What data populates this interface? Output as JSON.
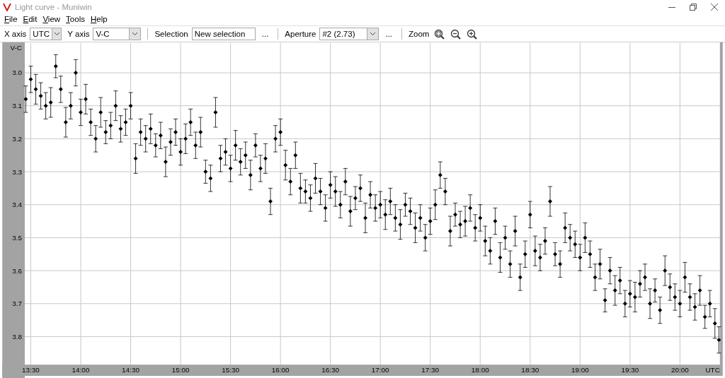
{
  "window": {
    "title": "Light curve - Muniwin"
  },
  "menu": [
    "File",
    "Edit",
    "View",
    "Tools",
    "Help"
  ],
  "toolbar": {
    "x_axis": {
      "label": "X axis",
      "value": "UTC"
    },
    "y_axis": {
      "label": "Y axis",
      "value": "V-C"
    },
    "selection": {
      "label": "Selection",
      "value": "New selection",
      "button": "..."
    },
    "aperture": {
      "label": "Aperture",
      "value": "#2 (2.73)",
      "button": "..."
    },
    "zoom": {
      "label": "Zoom"
    }
  },
  "chart": {
    "chart_data": {
      "type": "scatter",
      "xlabel": "UTC",
      "ylabel": "V-C",
      "grid": true,
      "xlim": [
        13.44,
        20.4
      ],
      "ylim": [
        3.885,
        2.91
      ],
      "xticks": [
        {
          "value": 13.5,
          "label": "13:30"
        },
        {
          "value": 14,
          "label": "14:00"
        },
        {
          "value": 14.5,
          "label": "14:30"
        },
        {
          "value": 15,
          "label": "15:00"
        },
        {
          "value": 15.5,
          "label": "15:30"
        },
        {
          "value": 16,
          "label": "16:00"
        },
        {
          "value": 16.5,
          "label": "16:30"
        },
        {
          "value": 17,
          "label": "17:00"
        },
        {
          "value": 17.5,
          "label": "17:30"
        },
        {
          "value": 18,
          "label": "18:00"
        },
        {
          "value": 18.5,
          "label": "18:30"
        },
        {
          "value": 19,
          "label": "19:00"
        },
        {
          "value": 19.5,
          "label": "19:30"
        },
        {
          "value": 20,
          "label": "20:00"
        }
      ],
      "yticks": [
        {
          "value": 3.0,
          "label": "3.0"
        },
        {
          "value": 3.1,
          "label": "3.1"
        },
        {
          "value": 3.2,
          "label": "3.2"
        },
        {
          "value": 3.3,
          "label": "3.3"
        },
        {
          "value": 3.4,
          "label": "3.4"
        },
        {
          "value": 3.5,
          "label": "3.5"
        },
        {
          "value": 3.6,
          "label": "3.6"
        },
        {
          "value": 3.7,
          "label": "3.7"
        },
        {
          "value": 3.8,
          "label": "3.8"
        }
      ],
      "x": [
        13.45,
        13.5,
        13.55,
        13.6,
        13.65,
        13.7,
        13.75,
        13.8,
        13.85,
        13.9,
        13.95,
        14,
        14.05,
        14.1,
        14.15,
        14.2,
        14.25,
        14.3,
        14.35,
        14.4,
        14.45,
        14.5,
        14.55,
        14.6,
        14.65,
        14.7,
        14.75,
        14.8,
        14.85,
        14.9,
        14.95,
        15,
        15.05,
        15.1,
        15.15,
        15.2,
        15.25,
        15.3,
        15.35,
        15.4,
        15.45,
        15.5,
        15.55,
        15.6,
        15.65,
        15.7,
        15.75,
        15.8,
        15.85,
        15.9,
        15.95,
        16,
        16.05,
        16.1,
        16.15,
        16.2,
        16.25,
        16.3,
        16.35,
        16.4,
        16.45,
        16.5,
        16.55,
        16.6,
        16.65,
        16.7,
        16.75,
        16.8,
        16.85,
        16.9,
        16.95,
        17,
        17.05,
        17.1,
        17.15,
        17.2,
        17.25,
        17.3,
        17.35,
        17.4,
        17.45,
        17.5,
        17.55,
        17.6,
        17.65,
        17.7,
        17.75,
        17.8,
        17.85,
        17.9,
        17.95,
        18,
        18.05,
        18.1,
        18.15,
        18.2,
        18.25,
        18.3,
        18.35,
        18.4,
        18.45,
        18.5,
        18.55,
        18.6,
        18.65,
        18.7,
        18.75,
        18.8,
        18.85,
        18.9,
        18.95,
        19,
        19.05,
        19.1,
        19.15,
        19.2,
        19.25,
        19.3,
        19.35,
        19.4,
        19.45,
        19.5,
        19.55,
        19.6,
        19.65,
        19.7,
        19.75,
        19.8,
        19.85,
        19.9,
        19.95,
        20,
        20.05,
        20.1,
        20.15,
        20.2,
        20.25,
        20.3,
        20.35,
        20.39
      ],
      "series": [
        {
          "color": "#000000",
          "errors": [
            0.04,
            0.04,
            0.045,
            0.04,
            0.04,
            0.045,
            0.035,
            0.04,
            0.045,
            0.04,
            0.04,
            0.04,
            0.045,
            0.04,
            0.04,
            0.045,
            0.035,
            0.04,
            0.045,
            0.04,
            0.04,
            0.04,
            0.045,
            0.04,
            0.04,
            0.045,
            0.035,
            0.04,
            0.045,
            0.04,
            0.04,
            0.04,
            0.045,
            0.04,
            0.04,
            0.045,
            0.035,
            0.04,
            0.045,
            0.04,
            0.04,
            0.04,
            0.045,
            0.04,
            0.04,
            0.045,
            0.035,
            0.04,
            0.045,
            0.04,
            0.04,
            0.04,
            0.045,
            0.04,
            0.04,
            0.045,
            0.035,
            0.04,
            0.045,
            0.04,
            0.04,
            0.04,
            0.045,
            0.04,
            0.04,
            0.045,
            0.035,
            0.04,
            0.045,
            0.04,
            0.04,
            0.04,
            0.045,
            0.04,
            0.04,
            0.045,
            0.035,
            0.04,
            0.045,
            0.04,
            0.04,
            0.04,
            0.045,
            0.04,
            0.04,
            0.045,
            0.035,
            0.04,
            0.045,
            0.04,
            0.04,
            0.04,
            0.045,
            0.04,
            0.04,
            0.045,
            0.035,
            0.04,
            0.045,
            0.04,
            0.04,
            0.04,
            0.045,
            0.04,
            0.04,
            0.045,
            0.035,
            0.04,
            0.045,
            0.04,
            0.04,
            0.04,
            0.045,
            0.04,
            0.04,
            0.045,
            0.035,
            0.04,
            0.045,
            0.04,
            0.04,
            0.04,
            0.045,
            0.04,
            0.04,
            0.045,
            0.035,
            0.04,
            0.045,
            0.04,
            0.04,
            0.04,
            0.045,
            0.04,
            0.04,
            0.045,
            0.035,
            0.04,
            0.045,
            0.04
          ],
          "values": [
            3.08,
            3.02,
            3.05,
            3.07,
            3.1,
            3.09,
            2.98,
            3.05,
            3.15,
            3.1,
            3.0,
            3.12,
            3.08,
            3.15,
            3.2,
            3.12,
            3.18,
            3.16,
            3.1,
            3.17,
            3.15,
            3.1,
            3.26,
            3.18,
            3.2,
            3.17,
            3.22,
            3.19,
            3.27,
            3.21,
            3.18,
            3.24,
            3.2,
            3.15,
            3.22,
            3.18,
            3.3,
            3.32,
            3.12,
            3.26,
            3.24,
            3.29,
            3.22,
            3.27,
            3.25,
            3.31,
            3.22,
            3.29,
            3.26,
            3.39,
            3.2,
            3.18,
            3.28,
            3.33,
            3.25,
            3.35,
            3.36,
            3.38,
            3.32,
            3.36,
            3.41,
            3.34,
            3.36,
            3.4,
            3.33,
            3.42,
            3.38,
            3.35,
            3.44,
            3.37,
            3.41,
            3.4,
            3.43,
            3.39,
            3.44,
            3.46,
            3.4,
            3.42,
            3.47,
            3.44,
            3.5,
            3.45,
            3.4,
            3.31,
            3.36,
            3.48,
            3.43,
            3.46,
            3.45,
            3.41,
            3.47,
            3.44,
            3.51,
            3.54,
            3.45,
            3.56,
            3.5,
            3.58,
            3.48,
            3.62,
            3.55,
            3.43,
            3.54,
            3.56,
            3.51,
            3.39,
            3.55,
            3.58,
            3.47,
            3.5,
            3.52,
            3.56,
            3.5,
            3.55,
            3.62,
            3.58,
            3.69,
            3.6,
            3.66,
            3.63,
            3.7,
            3.67,
            3.68,
            3.64,
            3.62,
            3.7,
            3.66,
            3.72,
            3.6,
            3.65,
            3.68,
            3.7,
            3.62,
            3.68,
            3.71,
            3.66,
            3.74,
            3.7,
            3.76,
            3.81
          ]
        }
      ]
    }
  }
}
